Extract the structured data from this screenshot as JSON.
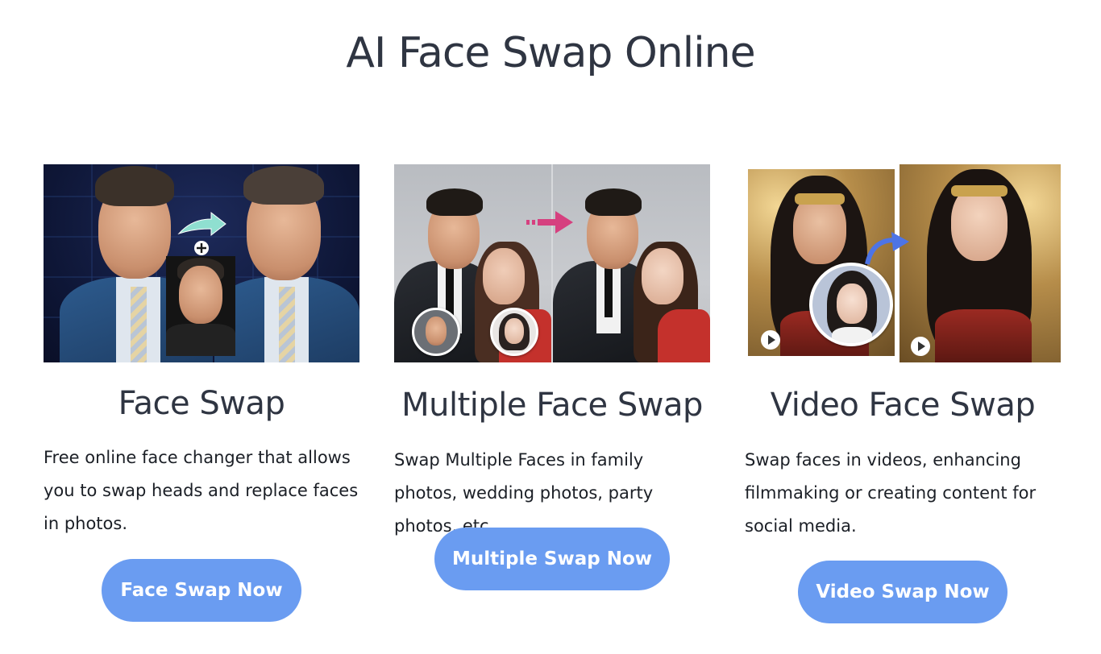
{
  "page": {
    "title": "AI Face Swap Online"
  },
  "cards": [
    {
      "title": "Face Swap",
      "description": "Free online face changer that allows you to swap heads and replace faces in photos.",
      "button_label": "Face Swap Now"
    },
    {
      "title": "Multiple Face Swap",
      "description": "Swap Multiple Faces in family photos, wedding photos, party photos, etc.",
      "button_label": "Multiple Swap Now"
    },
    {
      "title": "Video Face Swap",
      "description": "Swap faces in videos, enhancing filmmaking or creating content for social media.",
      "button_label": "Video Swap Now"
    }
  ],
  "icons": {
    "card1": [
      "arrow-right-icon",
      "plus-icon"
    ],
    "card2": [
      "arrow-right-icon"
    ],
    "card3": [
      "curved-arrow-icon",
      "play-icon"
    ]
  },
  "colors": {
    "heading": "#2f3542",
    "body_text": "#1b1f26",
    "button_bg": "#6a9cf1",
    "button_text": "#ffffff",
    "background": "#ffffff"
  }
}
